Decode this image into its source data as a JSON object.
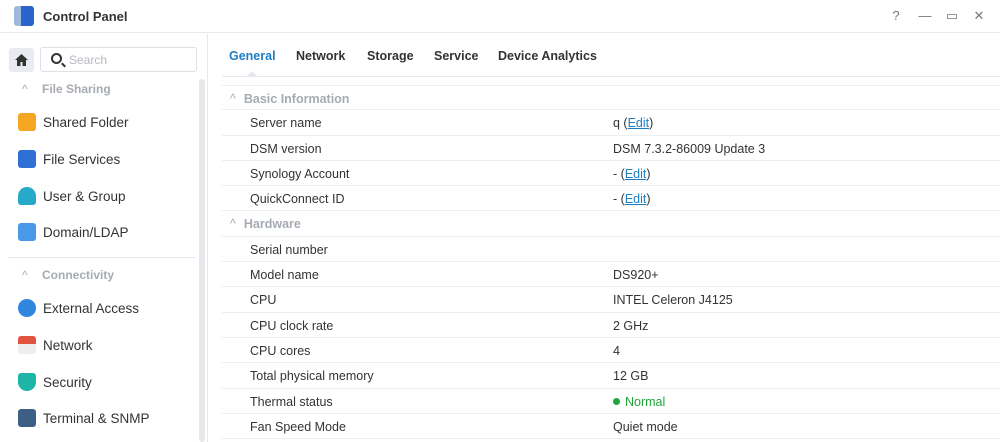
{
  "window": {
    "title": "Control Panel",
    "help": "?",
    "minimize": "—",
    "maximize": "▭",
    "close": "✕"
  },
  "sidebar": {
    "search_placeholder": "Search",
    "sections": [
      {
        "label": "File Sharing",
        "items": [
          {
            "label": "Shared Folder"
          },
          {
            "label": "File Services"
          },
          {
            "label": "User & Group"
          },
          {
            "label": "Domain/LDAP"
          }
        ]
      },
      {
        "label": "Connectivity",
        "items": [
          {
            "label": "External Access"
          },
          {
            "label": "Network"
          },
          {
            "label": "Security"
          },
          {
            "label": "Terminal & SNMP"
          }
        ]
      }
    ]
  },
  "tabs": [
    "General",
    "Network",
    "Storage",
    "Service",
    "Device Analytics"
  ],
  "basic": {
    "title": "Basic Information",
    "server_name": {
      "label": "Server name",
      "value": "q",
      "edit": "Edit"
    },
    "dsm": {
      "label": "DSM version",
      "value": "DSM 7.3.2-86009 Update 3"
    },
    "account": {
      "label": "Synology Account",
      "value": "-",
      "edit": "Edit"
    },
    "quickconnect": {
      "label": "QuickConnect ID",
      "value": "-",
      "edit": "Edit"
    }
  },
  "hardware": {
    "title": "Hardware",
    "rows": [
      {
        "label": "Serial number",
        "value": ""
      },
      {
        "label": "Model name",
        "value": "DS920+"
      },
      {
        "label": "CPU",
        "value": "INTEL Celeron J4125"
      },
      {
        "label": "CPU clock rate",
        "value": "2 GHz"
      },
      {
        "label": "CPU cores",
        "value": "4"
      },
      {
        "label": "Total physical memory",
        "value": "12 GB"
      }
    ],
    "thermal": {
      "label": "Thermal status",
      "value": "Normal",
      "color": "#1fa53a"
    },
    "fan": {
      "label": "Fan Speed Mode",
      "value": "Quiet mode"
    }
  }
}
